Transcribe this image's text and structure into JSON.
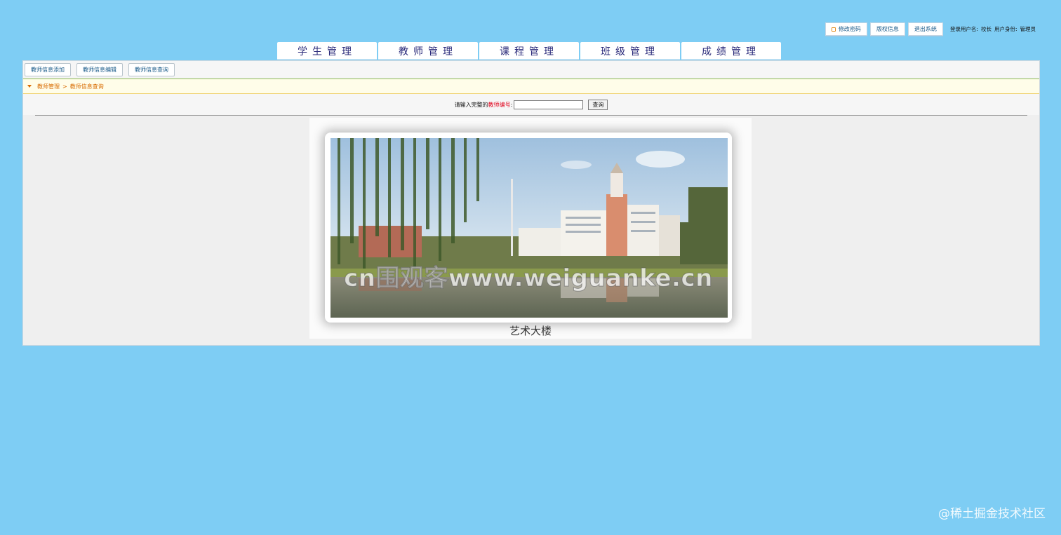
{
  "topbar": {
    "change_password": "修改密码",
    "copyright": "版权信息",
    "logout": "退出系统",
    "login_user_label": "登录用户名:",
    "login_user_value": "校长",
    "user_role_label": "用户身份:",
    "user_role_value": "管理员"
  },
  "main_nav": [
    "学生管理",
    "教师管理",
    "课程管理",
    "班级管理",
    "成绩管理"
  ],
  "sub_nav": [
    "教师信息添加",
    "教师信息编辑",
    "教师信息查询"
  ],
  "breadcrumb": {
    "parent": "教师管理",
    "separator": ">",
    "current": "教师信息查询"
  },
  "search": {
    "label_prefix": "请输入完整的",
    "label_highlight": "教师编号",
    "label_suffix": ":",
    "value": "",
    "button": "查询"
  },
  "image": {
    "watermark": "cn围观客www.weiguanke.cn",
    "caption": "艺术大楼"
  },
  "corner_watermark": "@稀土掘金技术社区",
  "colors": {
    "background": "#7ecdf4",
    "panel": "#efefef",
    "breadcrumb_text": "#d86b00",
    "highlight_red": "#e0001a"
  }
}
